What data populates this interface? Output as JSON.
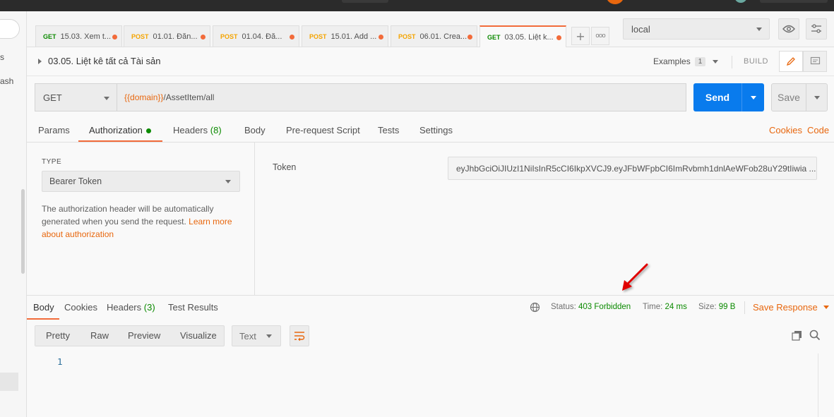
{
  "sidebar": {
    "partial_texts": [
      "s",
      "ash"
    ]
  },
  "tabs": [
    {
      "method": "GET",
      "label": "15.03. Xem t..."
    },
    {
      "method": "POST",
      "label": "01.01. Đăn..."
    },
    {
      "method": "POST",
      "label": "01.04. Đă..."
    },
    {
      "method": "POST",
      "label": "15.01. Add ..."
    },
    {
      "method": "POST",
      "label": "06.01. Crea..."
    },
    {
      "method": "GET",
      "label": "03.05. Liệt k..."
    }
  ],
  "tab_actions": {
    "new": "+",
    "more": "ooo"
  },
  "environment": {
    "selected": "local"
  },
  "request": {
    "name": "03.05. Liệt kê tất cả Tài sản",
    "examples_label": "Examples",
    "examples_count": "1",
    "build_label": "BUILD",
    "method": "GET",
    "url_var": "{{domain}}",
    "url_path": "/AssetItem/all",
    "send_label": "Send",
    "save_label": "Save"
  },
  "request_tabs": {
    "params": "Params",
    "authorization": "Authorization",
    "headers": "Headers",
    "headers_count": "(8)",
    "body": "Body",
    "prerequest": "Pre-request Script",
    "tests": "Tests",
    "settings": "Settings",
    "cookies": "Cookies",
    "code": "Code"
  },
  "auth": {
    "type_label": "TYPE",
    "type_value": "Bearer Token",
    "help_text": "The authorization header will be automatically generated when you send the request. ",
    "help_link": "Learn more about authorization",
    "token_label": "Token",
    "token_value": "eyJhbGciOiJIUzI1NiIsInR5cCI6IkpXVCJ9.eyJFbWFpbCI6ImRvbmh1dnlAeWFob28uY29tIiwia ..."
  },
  "response": {
    "tabs": {
      "body": "Body",
      "cookies": "Cookies",
      "headers": "Headers",
      "headers_count": "(3)",
      "test_results": "Test Results"
    },
    "status_label": "Status:",
    "status_value": "403 Forbidden",
    "time_label": "Time:",
    "time_value": "24 ms",
    "size_label": "Size:",
    "size_value": "99 B",
    "save_response": "Save Response",
    "view_modes": [
      "Pretty",
      "Raw",
      "Preview",
      "Visualize"
    ],
    "format": "Text",
    "line_number": "1"
  },
  "colors": {
    "accent": "#f26b3a",
    "send": "#097bed",
    "get": "#0b8a00",
    "post": "#f4a400",
    "status_ok_text": "#0b8a00",
    "arrow": "#e00000"
  }
}
